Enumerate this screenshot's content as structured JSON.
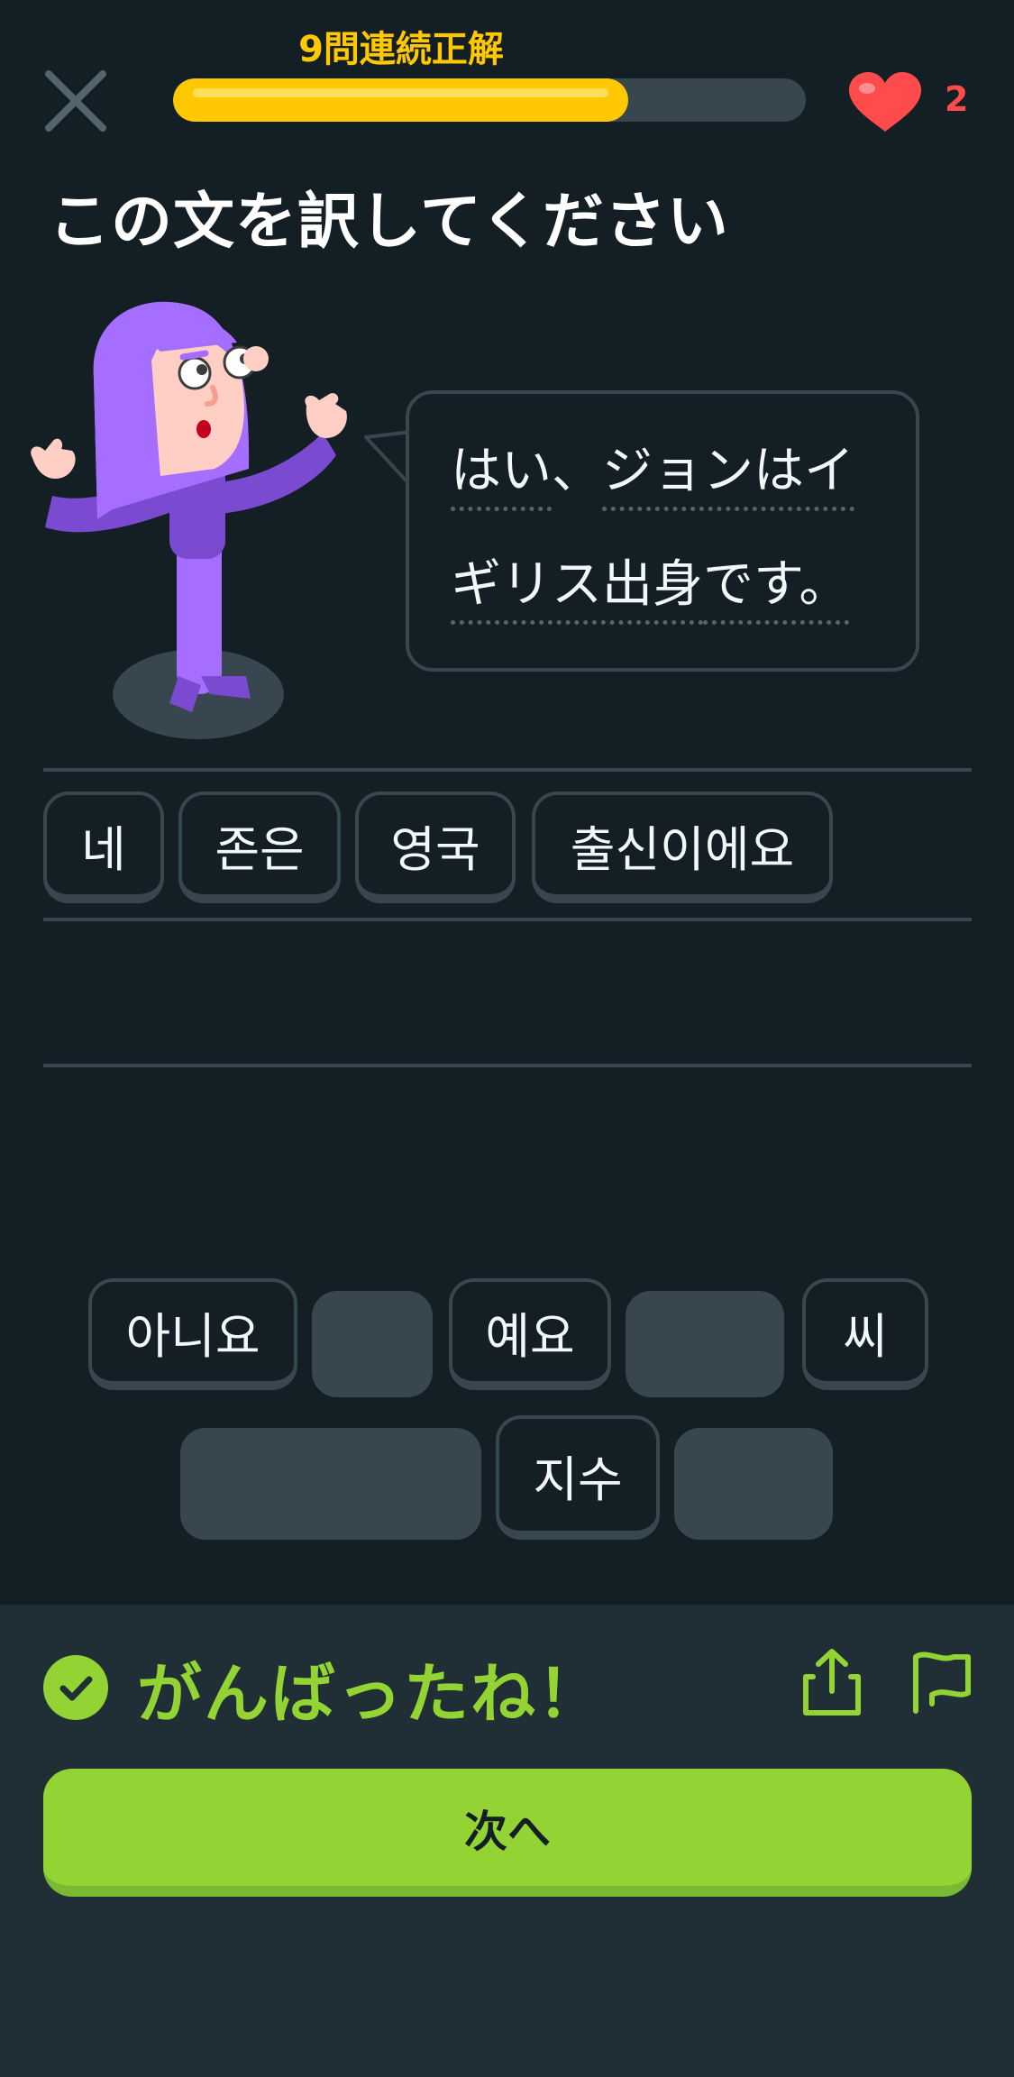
{
  "header": {
    "streak_label": "9問連続正解",
    "progress": 0.72,
    "hearts": "2",
    "close_icon": "close-icon",
    "heart_icon": "heart-icon"
  },
  "prompt": {
    "title": "この文を訳してください",
    "sentence_words": [
      [
        "はい",
        "、",
        "ジョンはイ"
      ],
      [
        "ギリス出身",
        "です。"
      ]
    ]
  },
  "answer": {
    "tiles": [
      "네",
      "존은",
      "영국",
      "출신이에요"
    ]
  },
  "word_bank": {
    "row1": [
      "아니요",
      "예요",
      "씨"
    ],
    "row2": [
      "지수"
    ]
  },
  "feedback": {
    "message": "がんばったね！",
    "next_label": "次へ",
    "status_icon": "check-circle-icon",
    "share_icon": "share-icon",
    "report_icon": "flag-icon"
  },
  "colors": {
    "background": "#131f24",
    "panel": "#202f36",
    "accent_green": "#93d333",
    "streak_gold": "#ffc800",
    "heart_red": "#ff4b4b",
    "character_purple": "#a56eff"
  }
}
